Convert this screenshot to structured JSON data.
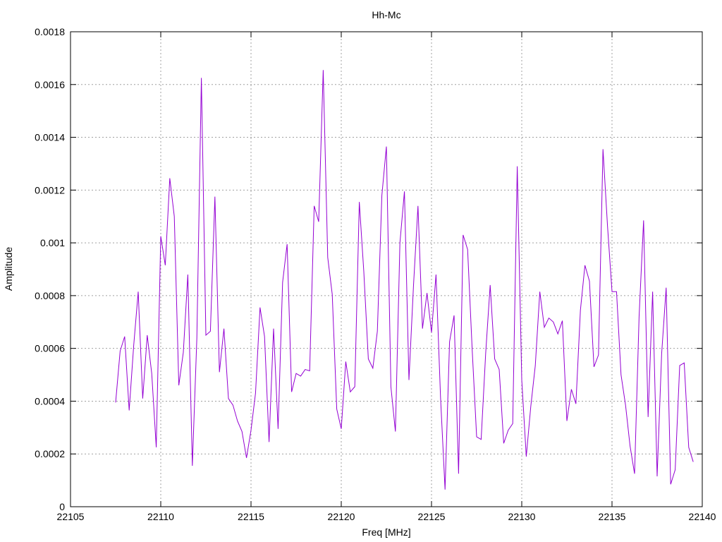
{
  "chart_data": {
    "type": "line",
    "title": "Hh-Mc",
    "xlabel": "Freq [MHz]",
    "ylabel": "Amplitude",
    "xlim": [
      22105,
      22140
    ],
    "ylim": [
      0,
      0.0018
    ],
    "x_ticks": [
      "22105",
      "22110",
      "22115",
      "22120",
      "22125",
      "22130",
      "22135",
      "22140"
    ],
    "y_ticks": [
      "0",
      "0.0002",
      "0.0004",
      "0.0006",
      "0.0008",
      "0.001",
      "0.0012",
      "0.0014",
      "0.0016",
      "0.0018"
    ],
    "grid": true,
    "line_color": "#9400d3",
    "series": [
      {
        "x": [
          22107.5,
          22107.75,
          22108.0,
          22108.25,
          22108.5,
          22108.75,
          22109.0,
          22109.25,
          22109.5,
          22109.75,
          22110.0,
          22110.25,
          22110.5,
          22110.75,
          22111.0,
          22111.25,
          22111.5,
          22111.75,
          22112.0,
          22112.25,
          22112.5,
          22112.75,
          22113.0,
          22113.25,
          22113.5,
          22113.75,
          22114.0,
          22114.25,
          22114.5,
          22114.75,
          22115.0,
          22115.25,
          22115.5,
          22115.75,
          22116.0,
          22116.25,
          22116.5,
          22116.75,
          22117.0,
          22117.25,
          22117.5,
          22117.75,
          22118.0,
          22118.25,
          22118.5,
          22118.75,
          22119.0,
          22119.25,
          22119.5,
          22119.75,
          22120.0,
          22120.25,
          22120.5,
          22120.75,
          22121.0,
          22121.25,
          22121.5,
          22121.75,
          22122.0,
          22122.25,
          22122.5,
          22122.75,
          22123.0,
          22123.25,
          22123.5,
          22123.75,
          22124.0,
          22124.25,
          22124.5,
          22124.75,
          22125.0,
          22125.25,
          22125.5,
          22125.75,
          22126.0,
          22126.25,
          22126.5,
          22126.75,
          22127.0,
          22127.25,
          22127.5,
          22127.75,
          22128.0,
          22128.25,
          22128.5,
          22128.75,
          22129.0,
          22129.25,
          22129.5,
          22129.75,
          22130.0,
          22130.25,
          22130.5,
          22130.75,
          22131.0,
          22131.25,
          22131.5,
          22131.75,
          22132.0,
          22132.25,
          22132.5,
          22132.75,
          22133.0,
          22133.25,
          22133.5,
          22133.75,
          22134.0,
          22134.25,
          22134.5,
          22134.75,
          22135.0,
          22135.25,
          22135.5,
          22135.75,
          22136.0,
          22136.25,
          22136.5,
          22136.75,
          22137.0,
          22137.25,
          22137.5,
          22137.75,
          22138.0,
          22138.25,
          22138.5,
          22138.75,
          22139.0,
          22139.25,
          22139.5
        ],
        "values": [
          0.000395,
          0.00059,
          0.000645,
          0.000365,
          0.00061,
          0.000815,
          0.00041,
          0.00065,
          0.000505,
          0.000225,
          0.001025,
          0.000915,
          0.001245,
          0.0011,
          0.00046,
          0.000585,
          0.00088,
          0.000155,
          0.00064,
          0.001625,
          0.00065,
          0.000665,
          0.001175,
          0.00051,
          0.000675,
          0.00041,
          0.000385,
          0.000325,
          0.000285,
          0.000185,
          0.00029,
          0.00043,
          0.000755,
          0.000645,
          0.000245,
          0.000675,
          0.000295,
          0.00085,
          0.000995,
          0.000435,
          0.000505,
          0.000495,
          0.00052,
          0.000515,
          0.00114,
          0.00108,
          0.001655,
          0.000945,
          0.000805,
          0.00037,
          0.000295,
          0.00055,
          0.000435,
          0.000455,
          0.001155,
          0.00089,
          0.00056,
          0.000525,
          0.000665,
          0.00118,
          0.001365,
          0.000455,
          0.000285,
          0.001,
          0.001195,
          0.00048,
          0.000835,
          0.00114,
          0.000675,
          0.00081,
          0.00066,
          0.00088,
          0.000415,
          6.5e-05,
          0.000625,
          0.000725,
          0.000125,
          0.00103,
          0.000975,
          0.0006,
          0.000265,
          0.000255,
          0.00058,
          0.00084,
          0.00056,
          0.00052,
          0.00024,
          0.00029,
          0.000315,
          0.00129,
          0.00048,
          0.00019,
          0.00038,
          0.000535,
          0.000815,
          0.00068,
          0.000715,
          0.0007,
          0.000655,
          0.000705,
          0.000325,
          0.000445,
          0.00039,
          0.000745,
          0.000915,
          0.000855,
          0.00053,
          0.000575,
          0.001355,
          0.001065,
          0.000815,
          0.000815,
          0.0005,
          0.000385,
          0.00023,
          0.000125,
          0.00072,
          0.001085,
          0.00034,
          0.000815,
          0.000115,
          0.00058,
          0.00083,
          8.5e-05,
          0.00014,
          0.000535,
          0.000545,
          0.000225,
          0.00017
        ]
      }
    ]
  }
}
